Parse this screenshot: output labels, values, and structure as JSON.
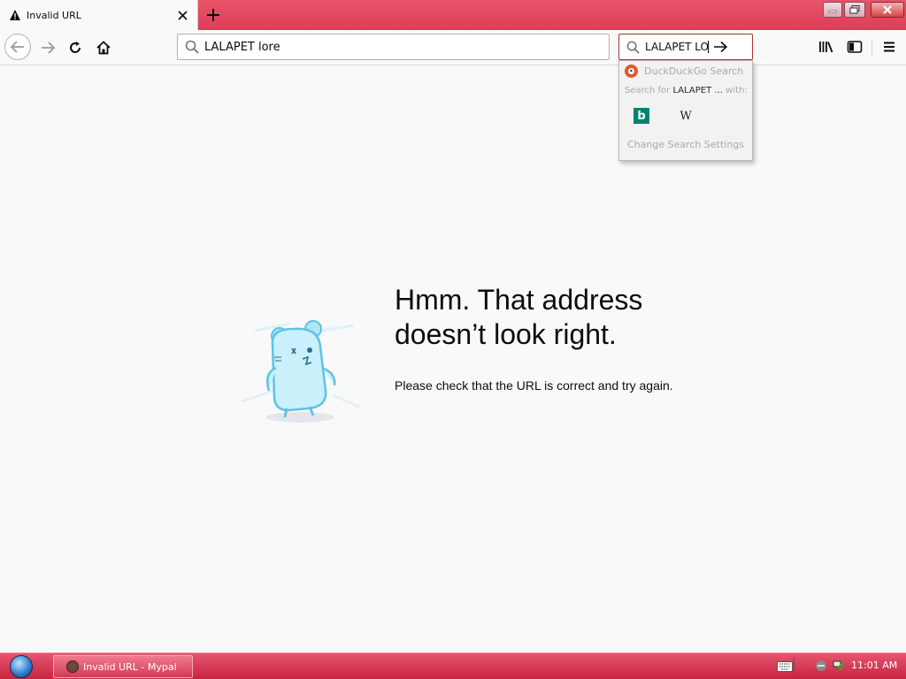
{
  "tab": {
    "title": "Invalid URL",
    "icon": "warning-icon",
    "close_icon": "close-icon"
  },
  "newtab": {
    "icon": "plus-icon"
  },
  "window_controls": {
    "minimize": "minimize-icon",
    "maximize": "restore-icon",
    "close": "close-icon"
  },
  "nav": {
    "back_icon": "back-arrow-icon",
    "forward_icon": "forward-arrow-icon",
    "reload_icon": "reload-icon",
    "home_icon": "home-icon"
  },
  "urlbar": {
    "value": "LALAPET lore",
    "icon": "search-icon"
  },
  "searchbar": {
    "value": "LALAPET LO",
    "icon": "search-icon",
    "go_icon": "arrow-right-icon"
  },
  "toolbar": {
    "library_icon": "library-icon",
    "sidebar_icon": "sidebar-icon",
    "menu_icon": "hamburger-menu-icon"
  },
  "search_popup": {
    "engine_label": "DuckDuckGo Search",
    "search_for_prefix": "Search for ",
    "search_for_query": "LALAPET ...",
    "search_for_suffix": " with:",
    "engines": [
      {
        "label": "b",
        "icon": "bing-icon"
      },
      {
        "label": "W",
        "icon": "wikipedia-icon"
      }
    ],
    "settings_label": "Change Search Settings"
  },
  "error_page": {
    "title_line1": "Hmm. That address",
    "title_line2": "doesn’t look right.",
    "body": "Please check that the URL is correct and try again."
  },
  "taskbar": {
    "task_label": "Invalid URL - Mypal",
    "clock": "11:01 AM"
  },
  "colors": {
    "accent": "#de3d57",
    "taskbar": "#d33a55",
    "page_bg": "#f9f9fa",
    "ddg": "#de5833",
    "bing": "#008373"
  }
}
